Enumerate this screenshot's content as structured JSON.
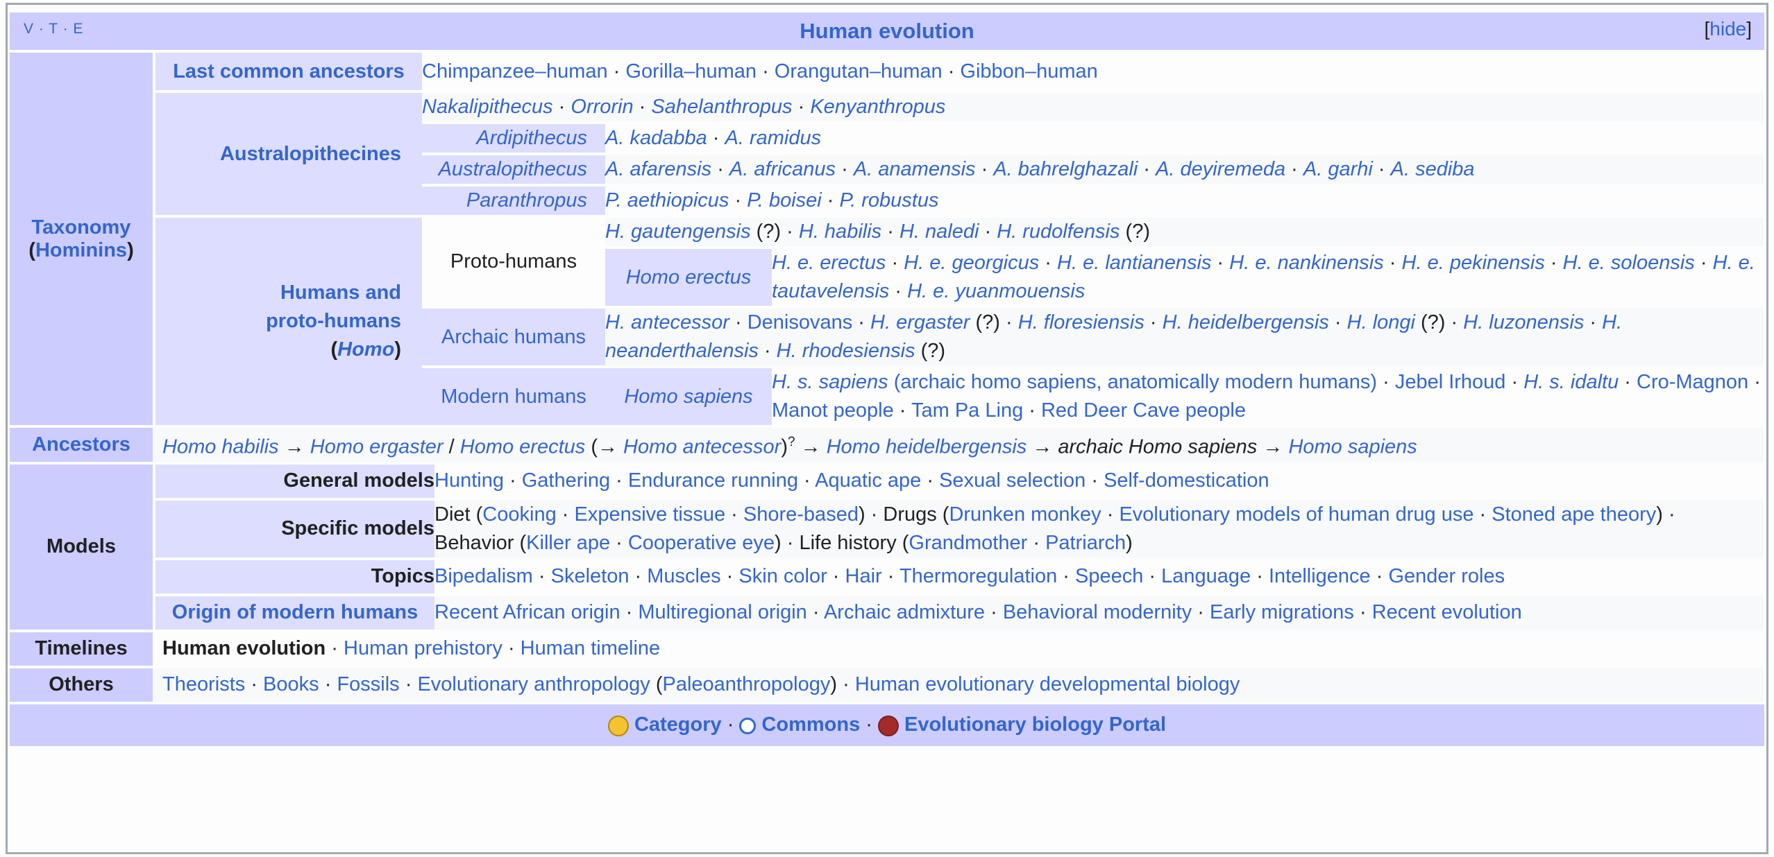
{
  "title": "Human evolution",
  "vte": "V · T · E",
  "hide": "hide",
  "taxonomy": {
    "label": "Taxonomy",
    "label_paren_open": "(",
    "label_sub": "Hominins",
    "label_paren_close": ")",
    "lca": {
      "label": "Last common ancestors",
      "items": [
        "Chimpanzee–human",
        "Gorilla–human",
        "Orangutan–human",
        "Gibbon–human"
      ]
    },
    "australopithecines": {
      "label": "Australopithecines",
      "intro": [
        "Nakalipithecus",
        "Orrorin",
        "Sahelanthropus",
        "Kenyanthropus"
      ],
      "ardipithecus": {
        "label": "Ardipithecus",
        "items": [
          "A. kadabba",
          "A. ramidus"
        ]
      },
      "australopithecus": {
        "label": "Australopithecus",
        "items": [
          "A. afarensis",
          "A. africanus",
          "A. anamensis",
          "A. bahrelghazali",
          "A. deyiremeda",
          "A. garhi",
          "A. sediba"
        ]
      },
      "paranthropus": {
        "label": "Paranthropus",
        "items": [
          "P. aethiopicus",
          "P. boisei",
          "P. robustus"
        ]
      }
    },
    "homo": {
      "label_1": "Humans and",
      "label_2": "proto-humans",
      "label_3_open": "(",
      "label_3_italic": "Homo",
      "label_3_close": ")",
      "proto": {
        "label": "Proto-humans",
        "h_gautengensis": "H. gautengensis",
        "q1": " (?)",
        "h_habilis": "H. habilis",
        "h_naledi": "H. naledi",
        "h_rudolfensis": "H. rudolfensis",
        "q2": " (?)",
        "erectus_label": "Homo erectus",
        "erectus_items": [
          "H. e. erectus",
          "H. e. georgicus",
          "H. e. lantianensis",
          "H. e. nankinensis",
          "H. e. pekinensis",
          "H. e. soloensis",
          "H. e. tautavelensis",
          "H. e. yuanmouensis"
        ]
      },
      "archaic": {
        "label": "Archaic humans",
        "antecessor": "H. antecessor",
        "denisovans": "Denisovans",
        "ergaster": "H. ergaster",
        "q1": " (?)",
        "floresiensis": "H. floresiensis",
        "heidelbergensis": "H. heidelbergensis",
        "longi": "H. longi",
        "q2": " (?)",
        "luzonensis": "H. luzonensis",
        "neanderthalensis": "H. neanderthalensis",
        "rhodesiensis": "H. rhodesiensis",
        "q3": " (?)"
      },
      "modern": {
        "label": "Modern humans",
        "sapiens_label": "Homo sapiens",
        "hss_italic": "H. s. sapiens",
        "hss_rest": " (archaic homo sapiens, anatomically modern humans)",
        "jebel": "Jebel Irhoud",
        "idaltu": "H. s. idaltu",
        "cromagnon": "Cro-Magnon",
        "manot": "Manot people",
        "tampaling": "Tam Pa Ling",
        "reddeer": "Red Deer Cave people"
      }
    }
  },
  "ancestors": {
    "label": "Ancestors",
    "habilis": "Homo habilis",
    "arrow1": " → ",
    "ergaster": "Homo ergaster",
    "slash": " / ",
    "erectus": "Homo erectus",
    "paren_arrow": " (→ ",
    "antecessor": "Homo antecessor",
    "close_paren": ")",
    "sup": "?",
    "arrow2": " → ",
    "heidelbergensis": "Homo heidelbergensis",
    "arrow3": " → ",
    "archaic": "archaic Homo sapiens",
    "arrow4": " → ",
    "sapiens": "Homo sapiens"
  },
  "models": {
    "label": "Models",
    "general": {
      "label": "General models",
      "items": [
        "Hunting",
        "Gathering",
        "Endurance running",
        "Aquatic ape",
        "Sexual selection",
        "Self-domestication"
      ]
    },
    "specific": {
      "label": "Specific models",
      "diet_open": "Diet (",
      "diet_items": [
        "Cooking",
        "Expensive tissue",
        "Shore-based"
      ],
      "drugs_open": ") · Drugs (",
      "drugs_items": [
        "Drunken monkey",
        "Evolutionary models of human drug use",
        "Stoned ape theory"
      ],
      "behavior_open": ") · Behavior (",
      "behavior_items": [
        "Killer ape",
        "Cooperative eye"
      ],
      "life_open": ") · Life history (",
      "life_items": [
        "Grandmother",
        "Patriarch"
      ],
      "close": ")"
    },
    "topics": {
      "label": "Topics",
      "items": [
        "Bipedalism",
        "Skeleton",
        "Muscles",
        "Skin color",
        "Hair",
        "Thermoregulation",
        "Speech",
        "Language",
        "Intelligence",
        "Gender roles"
      ]
    },
    "origin": {
      "label": "Origin of modern humans",
      "items": [
        "Recent African origin",
        "Multiregional origin",
        "Archaic admixture",
        "Behavioral modernity",
        "Early migrations",
        "Recent evolution"
      ]
    }
  },
  "timelines": {
    "label": "Timelines",
    "current": "Human evolution",
    "items": [
      "Human prehistory",
      "Human timeline"
    ]
  },
  "others": {
    "label": "Others",
    "items": [
      "Theorists",
      "Books",
      "Fossils",
      "Evolutionary anthropology"
    ],
    "paleo_open": " (",
    "paleo": "Paleoanthropology",
    "paleo_close": ")",
    "last": "Human evolutionary developmental biology"
  },
  "footer": {
    "category": "Category",
    "commons": "Commons",
    "portal": "Evolutionary biology Portal"
  },
  "separator": " · ",
  "colors": {
    "link": "#3366cc",
    "header_bg": "#ccccff",
    "group_bg": "#ddddff",
    "row_alt": "#f8f9fa"
  }
}
